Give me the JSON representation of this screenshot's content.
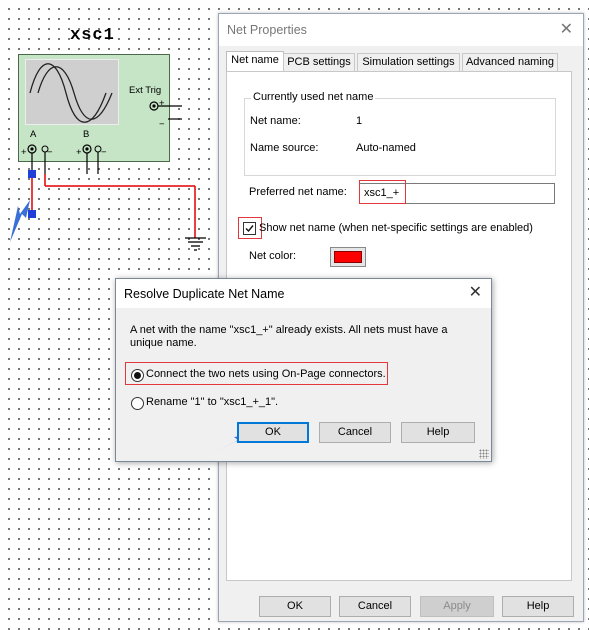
{
  "schematic": {
    "instrument_label": "xsc1",
    "channel_a_label": "A",
    "channel_b_label": "B",
    "ext_trig_label": "Ext Trig",
    "plus_sign": "+",
    "minus_sign": "−",
    "wire_color": "#e00000"
  },
  "net_properties": {
    "title": "Net Properties",
    "tabs": [
      {
        "label": "Net name",
        "active": true
      },
      {
        "label": "PCB settings",
        "active": false
      },
      {
        "label": "Simulation settings",
        "active": false
      },
      {
        "label": "Advanced naming",
        "active": false
      }
    ],
    "group_title": "Currently used net name",
    "net_name_label": "Net name:",
    "net_name_value": "1",
    "name_source_label": "Name source:",
    "name_source_value": "Auto-named",
    "preferred_label": "Preferred net name:",
    "preferred_value": "xsc1_+",
    "show_net_name_label": "Show net name (when net-specific settings are enabled)",
    "show_net_name_checked": true,
    "net_color_label": "Net color:",
    "net_color": "#ff0000",
    "buttons": {
      "ok": "OK",
      "cancel": "Cancel",
      "apply": "Apply",
      "help": "Help"
    }
  },
  "resolve_dialog": {
    "title": "Resolve Duplicate Net Name",
    "message": "A net with the name \"xsc1_+\" already exists. All nets must have a unique name.",
    "option_connect": "Connect the two nets using On-Page connectors.",
    "option_rename": "Rename \"1\" to \"xsc1_+_1\".",
    "selected_option": "connect",
    "buttons": {
      "ok": "OK",
      "cancel": "Cancel",
      "help": "Help"
    }
  },
  "colors": {
    "highlight_frame": "#e2383b",
    "pointer_arrow": "#3a6fd8",
    "scope_body": "#c6e4c6"
  }
}
